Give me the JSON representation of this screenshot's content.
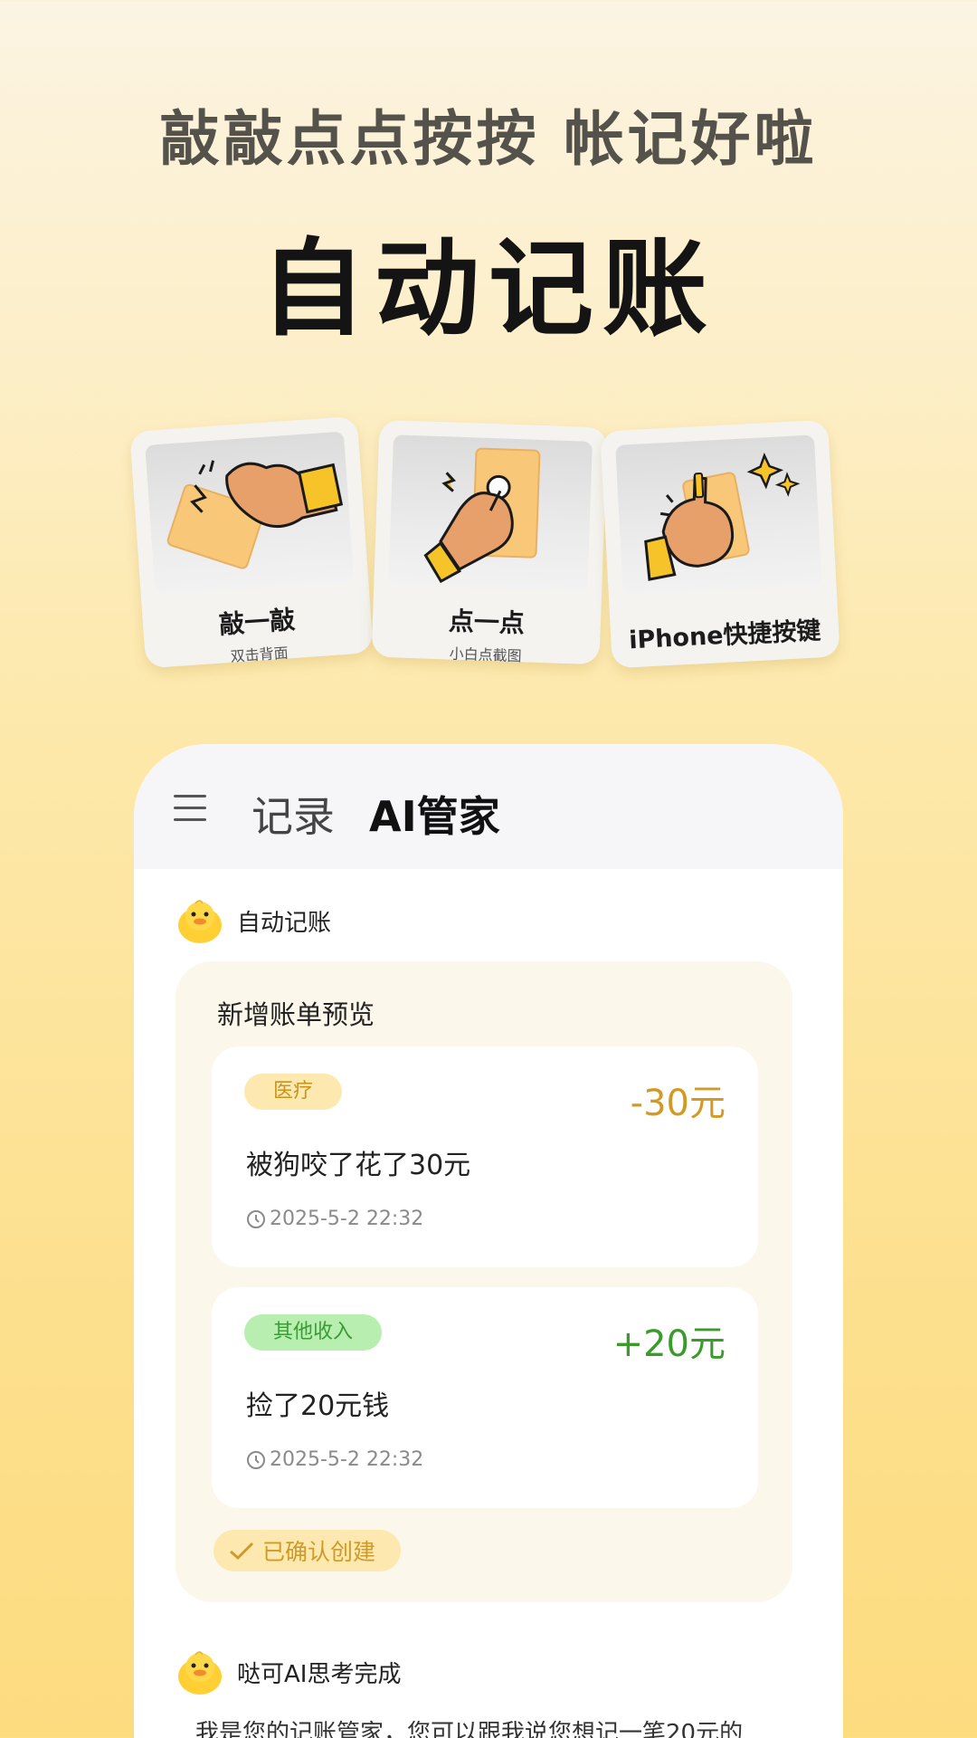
{
  "subtitle": "敲敲点点按按 帐记好啦",
  "headline": "自动记账",
  "features": [
    {
      "title": "敲一敲",
      "sub": "双击背面"
    },
    {
      "title": "点一点",
      "sub": "小白点截图"
    },
    {
      "title": "iPhone快捷按键"
    }
  ],
  "phone": {
    "tabs": {
      "record": "记录",
      "ai": "AI管家"
    },
    "bot1_name": "自动记账",
    "preview_title": "新增账单预览",
    "bills": [
      {
        "tag": "医疗",
        "amount": "-30元",
        "desc": "被狗咬了花了30元",
        "time": "2025-5-2  22:32"
      },
      {
        "tag": "其他收入",
        "amount": "+20元",
        "desc": "捡了20元钱",
        "time": "2025-5-2  22:32"
      }
    ],
    "confirm_label": "已确认创建",
    "bot2_name": "哒可AI思考完成",
    "ai_message": "我是您的记账管家，您可以跟我说您想记一笔20元的"
  },
  "colors": {
    "accent_yellow": "#fde08e",
    "expense": "#d39a23",
    "income": "#3a9b2b"
  }
}
